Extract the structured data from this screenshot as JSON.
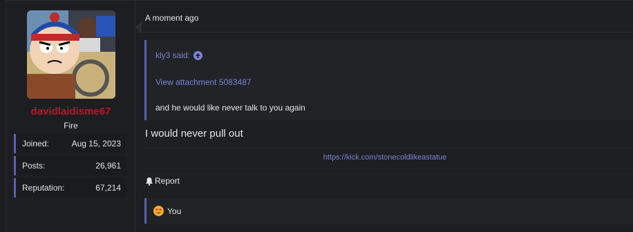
{
  "user": {
    "name": "davidlaidisme67",
    "title": "Fire",
    "stats": [
      {
        "label": "Joined:",
        "value": "Aug 15, 2023"
      },
      {
        "label": "Posts:",
        "value": "26,961"
      },
      {
        "label": "Reputation:",
        "value": "67,214"
      }
    ]
  },
  "post": {
    "timestamp": "A moment ago",
    "quote": {
      "author_said": "kly3 said:",
      "attachment": "View attachment 5083487",
      "text": "and he would like never talk to you again"
    },
    "body": "I would never pull out",
    "signature_link": "https://kick.com/stonecoldlikeastatue",
    "report_label": "Report",
    "reaction_users": "You"
  },
  "colors": {
    "accent": "#5a5fb0",
    "link": "#7b82d6",
    "username": "#c0142a",
    "background": "#1e1f22"
  }
}
